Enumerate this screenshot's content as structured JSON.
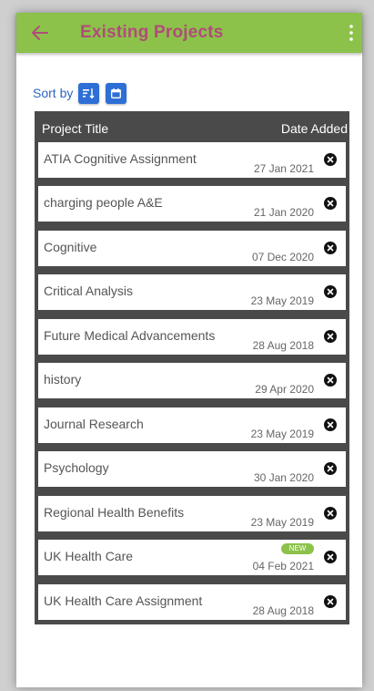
{
  "header": {
    "title": "Existing Projects",
    "back_icon": "arrow-left-icon",
    "menu_icon": "more-vertical-icon"
  },
  "sort": {
    "label": "Sort by",
    "buttons": [
      {
        "icon": "sort-alphabetical-icon"
      },
      {
        "icon": "calendar-icon"
      }
    ]
  },
  "table": {
    "columns": {
      "title": "Project Title",
      "date": "Date Added"
    },
    "rows": [
      {
        "title": "ATIA Cognitive Assignment",
        "date": "27 Jan 2021",
        "badge": ""
      },
      {
        "title": "charging people A&E",
        "date": "21 Jan 2020",
        "badge": ""
      },
      {
        "title": "Cognitive",
        "date": "07 Dec 2020",
        "badge": ""
      },
      {
        "title": "Critical Analysis",
        "date": "23 May 2019",
        "badge": ""
      },
      {
        "title": "Future Medical Advancements",
        "date": "28 Aug 2018",
        "badge": ""
      },
      {
        "title": "history",
        "date": "29 Apr 2020",
        "badge": ""
      },
      {
        "title": "Journal Research",
        "date": "23 May 2019",
        "badge": ""
      },
      {
        "title": "Psychology",
        "date": "30 Jan 2020",
        "badge": ""
      },
      {
        "title": "Regional Health Benefits",
        "date": "23 May 2019",
        "badge": ""
      },
      {
        "title": "UK Health Care",
        "date": "04 Feb 2021",
        "badge": "NEW"
      },
      {
        "title": "UK Health Care Assignment",
        "date": "28 Aug 2018",
        "badge": ""
      }
    ]
  },
  "colors": {
    "appbar": "#8cc24a",
    "title": "#b04c79",
    "accent": "#2e6fd6",
    "table_bg": "#4a4a4a",
    "badge": "#8cc24a"
  }
}
